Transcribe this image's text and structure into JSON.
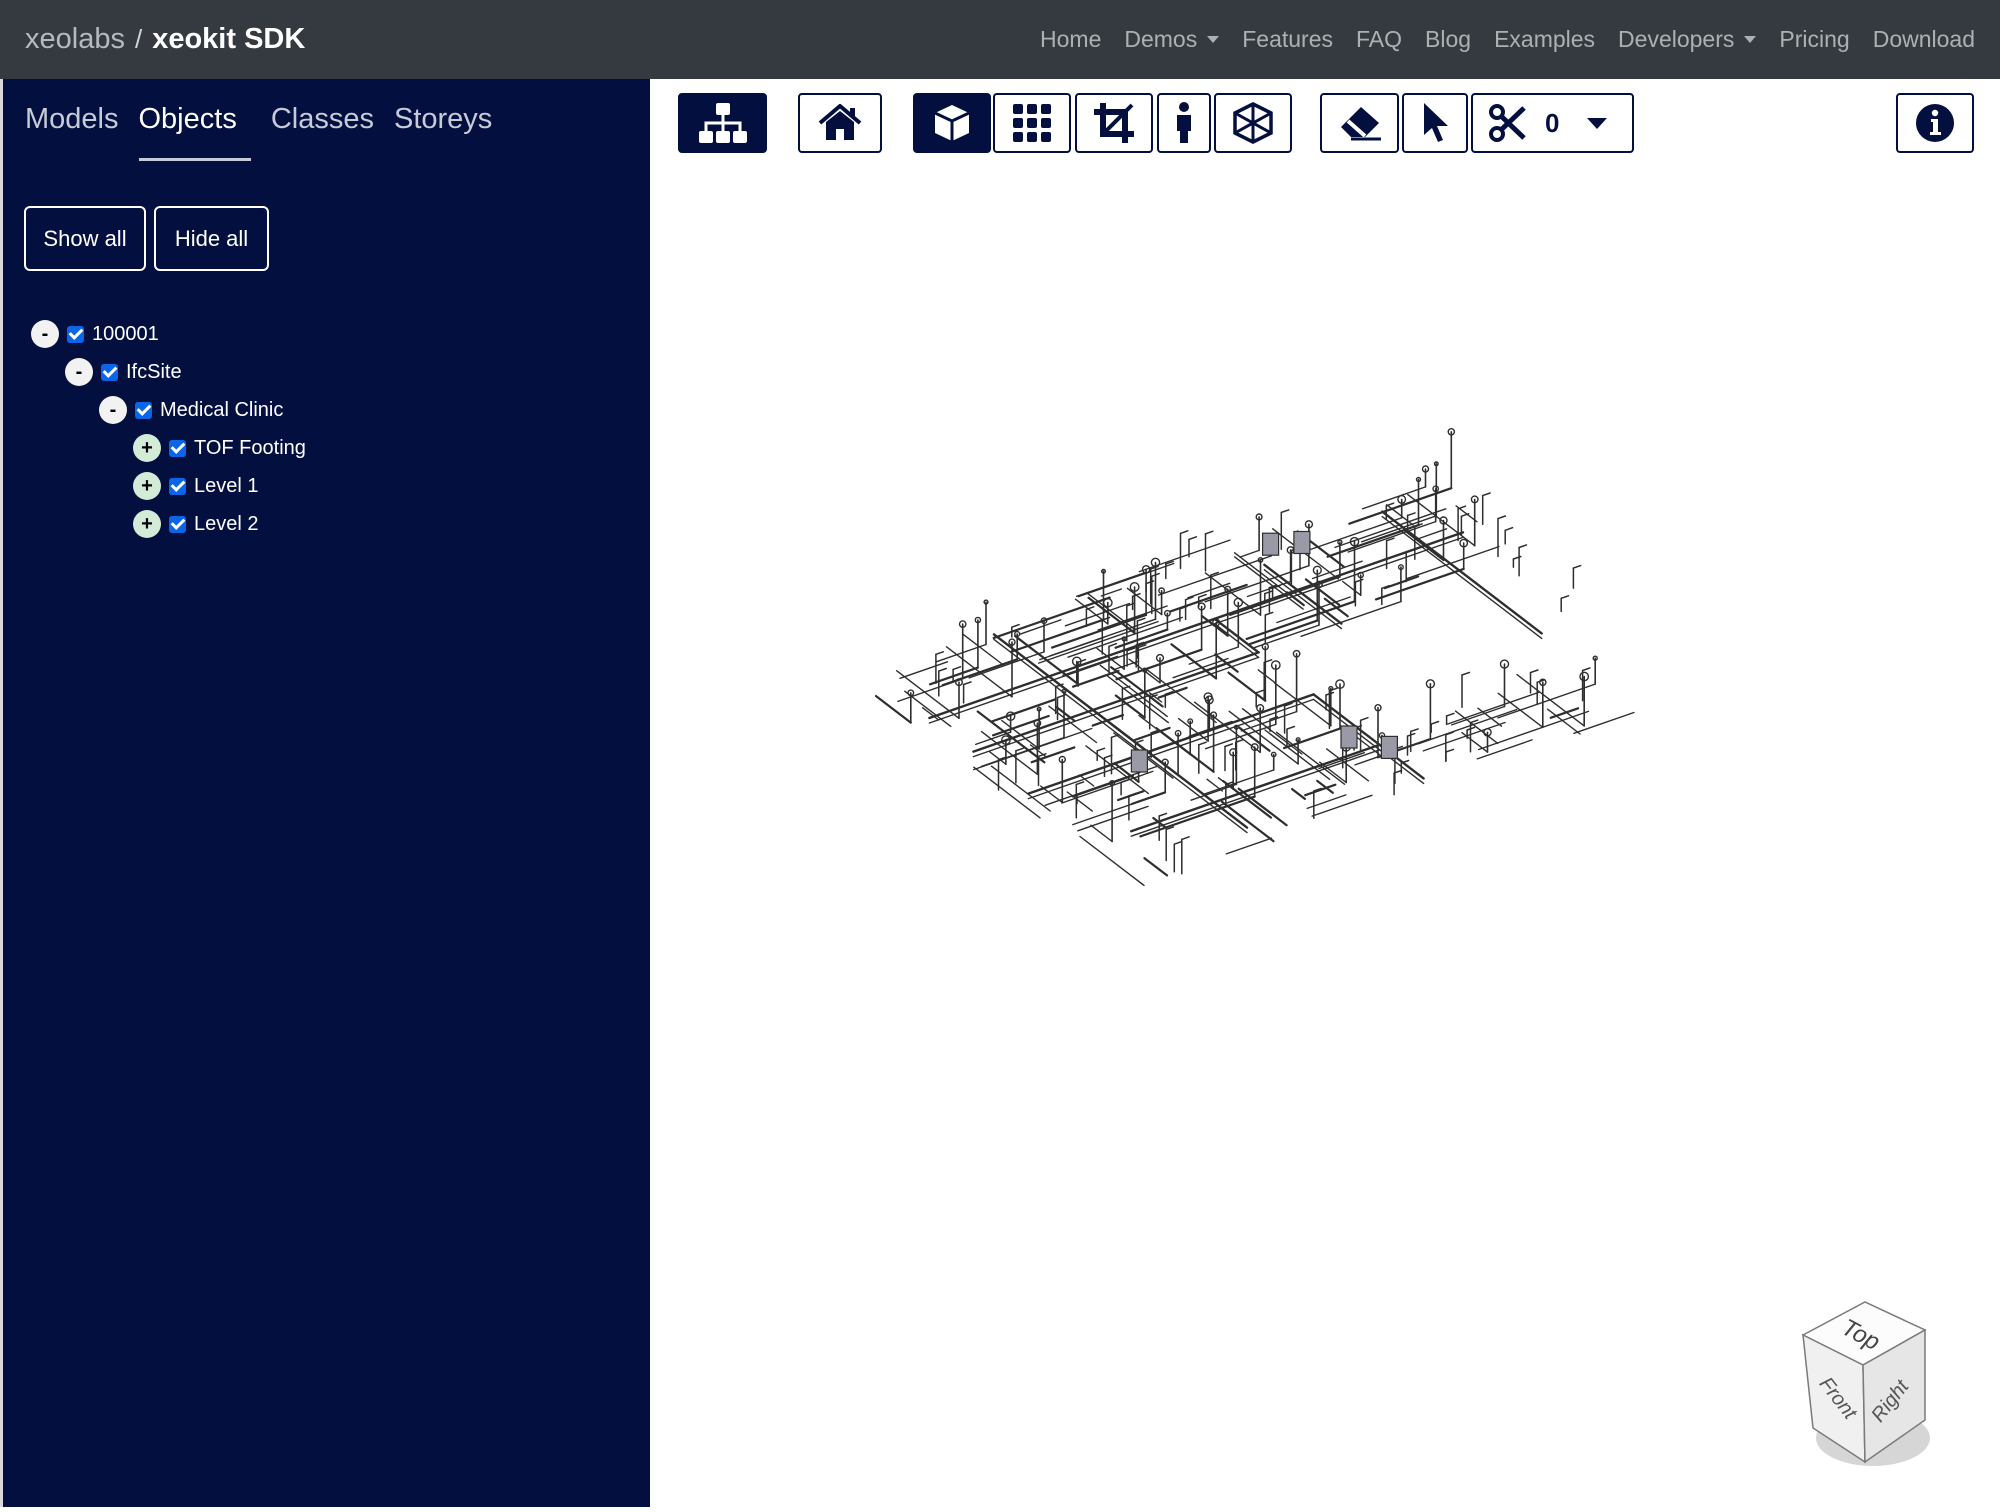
{
  "navbar": {
    "org": "xeolabs",
    "separator": "/",
    "product": "xeokit SDK",
    "links": [
      "Home",
      "Demos",
      "Features",
      "FAQ",
      "Blog",
      "Examples",
      "Developers",
      "Pricing",
      "Download"
    ]
  },
  "explorer": {
    "tabs": [
      "Models",
      "Objects",
      "Classes",
      "Storeys"
    ],
    "active_tab": "Objects",
    "show_all": "Show all",
    "hide_all": "Hide all",
    "tree": [
      {
        "label": "100001",
        "toggle": "-",
        "checked": true
      },
      {
        "label": "IfcSite",
        "toggle": "-",
        "checked": true
      },
      {
        "label": "Medical Clinic",
        "toggle": "-",
        "checked": true
      },
      {
        "label": "TOF Footing",
        "toggle": "+",
        "checked": true
      },
      {
        "label": "Level 1",
        "toggle": "+",
        "checked": true
      },
      {
        "label": "Level 2",
        "toggle": "+",
        "checked": true
      }
    ]
  },
  "toolbar": {
    "section_count": "0",
    "icons": [
      "explorer-tree-icon",
      "home-icon",
      "perspective-cube-icon",
      "ortho-grid-icon",
      "fit-crop-icon",
      "first-person-icon",
      "query-cube-icon",
      "eraser-icon",
      "select-pointer-icon",
      "scissors-section-icon",
      "info-icon"
    ]
  },
  "navcube": {
    "top": "Top",
    "front": "Front",
    "right": "Right"
  },
  "colors": {
    "navbar": "#343a40",
    "panel": "#03103f",
    "checkbox": "#0a66e6",
    "toolbar_icon": "#03103f"
  }
}
